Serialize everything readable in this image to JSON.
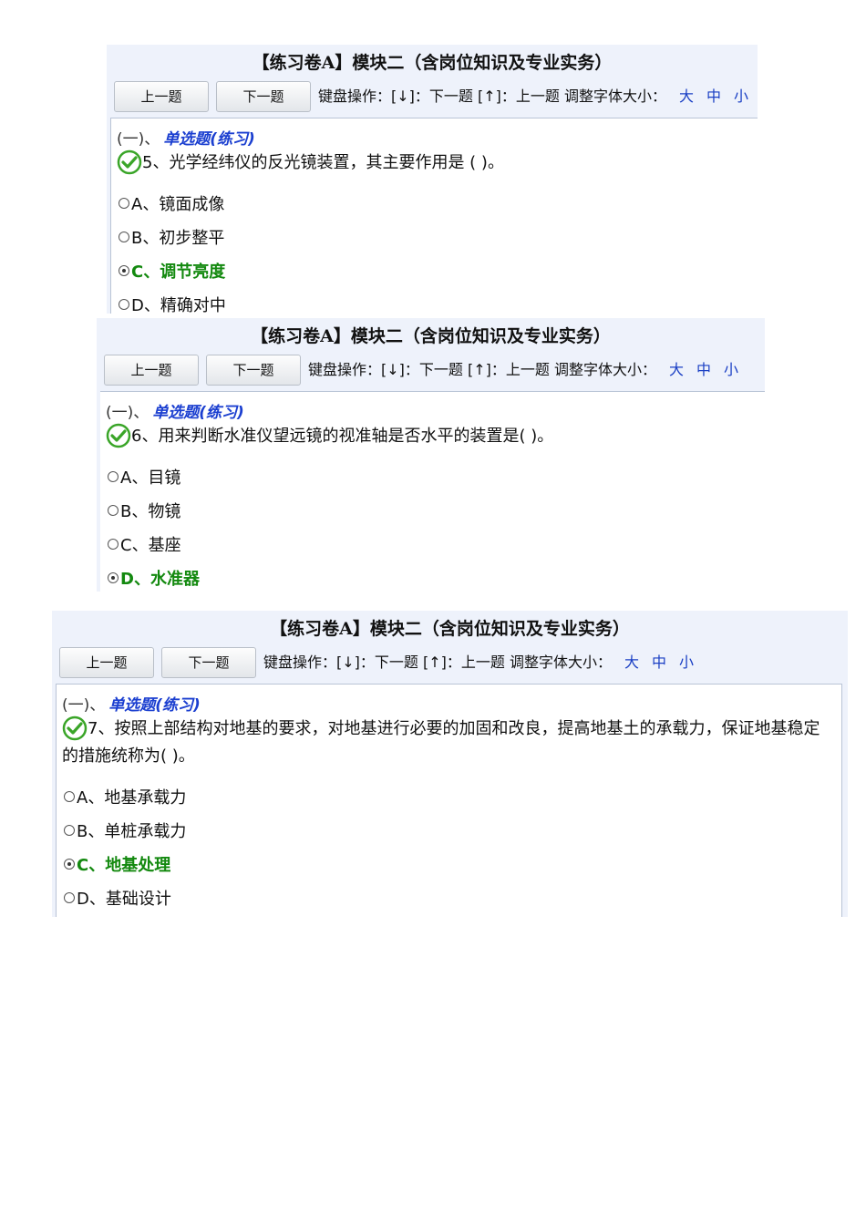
{
  "common": {
    "title": "【练习卷A】模块二（含岗位知识及专业实务）",
    "prev_label": "上一题",
    "next_label": "下一题",
    "keyboard_hint": "键盘操作：[↓]：下一题 [↑]：上一题  调整字体大小：",
    "font_large": "大",
    "font_medium": "中",
    "font_small": "小",
    "section_number": "(一)、",
    "section_type": "单选题(练习)",
    "correct_color": "#13890f",
    "accent_color": "#1b3fd0"
  },
  "questions": [
    {
      "text": "5、光学经纬仪的反光镜装置，其主要作用是 (     )。",
      "options": [
        "A、镜面成像",
        "B、初步整平",
        "C、调节亮度",
        "D、精确对中"
      ],
      "selected": "C"
    },
    {
      "text": "6、用来判断水准仪望远镜的视准轴是否水平的装置是(     )。",
      "options": [
        "A、目镜",
        "B、物镜",
        "C、基座",
        "D、水准器"
      ],
      "selected": "D"
    },
    {
      "text": "7、按照上部结构对地基的要求，对地基进行必要的加固和改良，提高地基土的承载力，保证地基稳定的措施统称为(     )。",
      "options": [
        "A、地基承载力",
        "B、单桩承载力",
        "C、地基处理",
        "D、基础设计"
      ],
      "selected": "C"
    }
  ]
}
